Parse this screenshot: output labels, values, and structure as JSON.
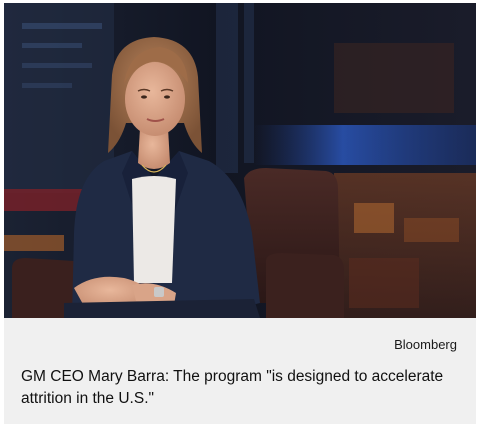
{
  "photo": {
    "alt": "Mary Barra seated in a leather armchair in a television studio"
  },
  "credit": "Bloomberg",
  "caption": "GM CEO Mary Barra: The program \"is designed to accelerate attrition in the U.S.\""
}
